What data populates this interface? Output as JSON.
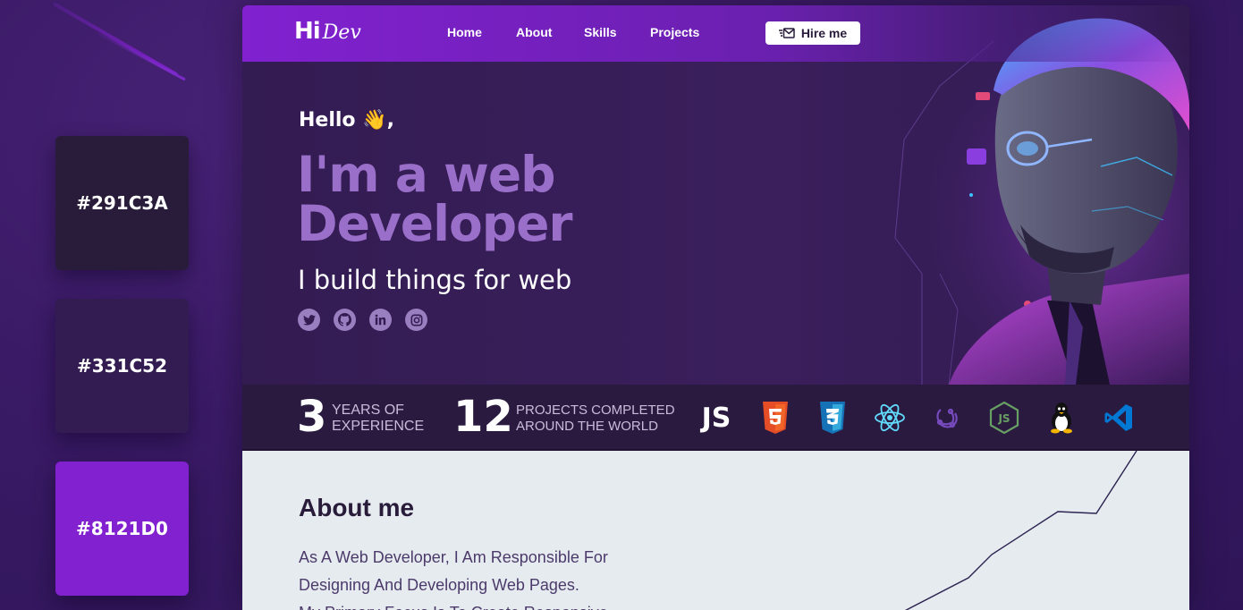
{
  "palette": {
    "swatches": [
      {
        "label": "#291C3A",
        "color": "#291c3a"
      },
      {
        "label": "#331C52",
        "color": "#331c52"
      },
      {
        "label": "#8121D0",
        "color": "#8121d0"
      }
    ]
  },
  "nav": {
    "logo_mark": "Hi",
    "logo_sub": "Dev",
    "links": [
      "Home",
      "About",
      "Skills",
      "Projects"
    ],
    "hire_label": "Hire me",
    "hire_icon": "mail-icon"
  },
  "hero": {
    "greeting": "Hello 👋,",
    "headline_line1": "I'm a web",
    "headline_line2": "Developer",
    "tagline": "I build things for web",
    "socials": [
      "twitter-icon",
      "github-icon",
      "linkedin-icon",
      "instagram-icon"
    ]
  },
  "stats": {
    "years_value": "3",
    "years_label_1": "YEARS OF",
    "years_label_2": "EXPERIENCE",
    "projects_value": "12",
    "projects_label_1": "PROJECTS COMPLETED",
    "projects_label_2": "AROUND THE WORLD",
    "tech": [
      "JS",
      "html5-icon",
      "css3-icon",
      "react-icon",
      "redux-icon",
      "nodejs-icon",
      "linux-icon",
      "vscode-icon"
    ]
  },
  "about": {
    "title": "About me",
    "lines": [
      "As A Web Developer, I Am Responsible For",
      "Designing And Developing Web Pages.",
      "My Primary Focus Is To Create Responsive"
    ]
  },
  "colors": {
    "brand_purple": "#8121d0",
    "dark_bg": "#291c3a",
    "hero_bg": "#331c52",
    "headline": "#9a6fc9"
  }
}
